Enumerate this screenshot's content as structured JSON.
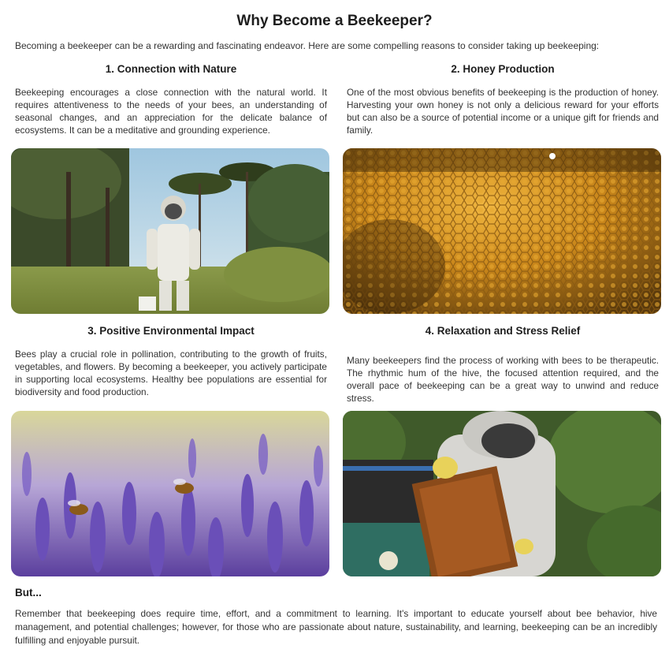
{
  "title": "Why Become a Beekeeper?",
  "intro": "Becoming a beekeeper can be a rewarding and fascinating endeavor. Here are some compelling reasons to consider taking up beekeeping:",
  "sections": [
    {
      "heading": "1. Connection with Nature",
      "text": "Beekeeping encourages a close connection with the natural world. It requires attentiveness to the needs of your bees, an understanding of seasonal changes, and an appreciation for the delicate balance of ecosystems. It can be a meditative and grounding experience."
    },
    {
      "heading": "2. Honey Production",
      "text": "One of the most obvious benefits of beekeeping is the production of honey. Harvesting your own honey is not only a delicious reward for your efforts but can also be a source of potential income or a unique gift for friends and family."
    },
    {
      "heading": "3. Positive Environmental Impact",
      "text": "Bees play a crucial role in pollination, contributing to the growth of fruits, vegetables, and flowers. By becoming a beekeeper, you actively participate in supporting local ecosystems. Healthy bee populations are essential for biodiversity and food production."
    },
    {
      "heading": "4. Relaxation and Stress Relief",
      "text": "Many beekeepers find the process of working with bees to be therapeutic. The rhythmic hum of the hive, the focused attention required, and the overall pace of beekeeping can be a great way to unwind and reduce stress."
    }
  ],
  "but": {
    "heading": "But...",
    "text": "Remember that beekeeping does require time, effort, and a commitment to learning. It's important to educate yourself about bee behavior, hive management, and potential challenges; however, for those who are passionate about nature, sustainability, and learning, beekeeping can be an incredibly fulfilling and enjoyable pursuit."
  },
  "colors": {
    "honey": "#c9861a",
    "lavender": "#6a4fb8",
    "forest": "#3f5a2a",
    "sky": "#a9cfe6"
  }
}
